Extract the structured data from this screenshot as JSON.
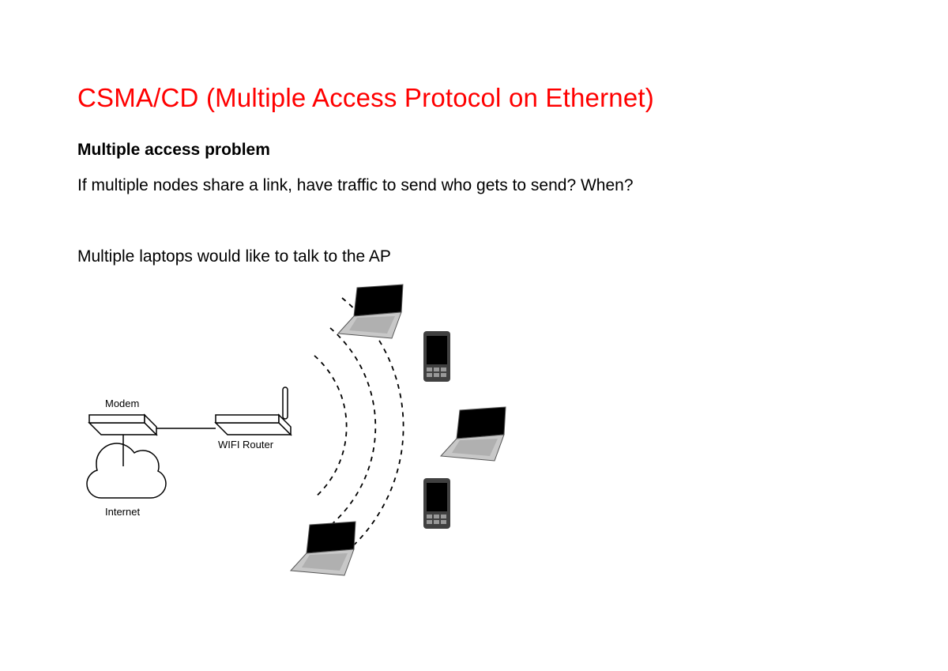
{
  "title": "CSMA/CD (Multiple Access Protocol on Ethernet)",
  "subheading": "Multiple access problem",
  "paragraph1": "If multiple nodes share a link, have traffic to send who gets to send? When?",
  "paragraph2": "Multiple laptops would like to talk to the AP",
  "diagram": {
    "modem_label": "Modem",
    "router_label": "WIFI Router",
    "internet_label": "Internet"
  }
}
